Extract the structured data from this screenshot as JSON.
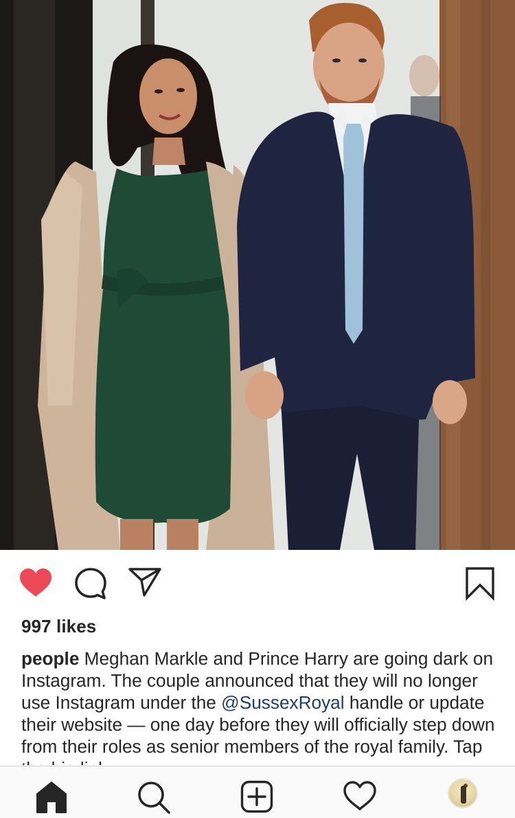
{
  "post": {
    "photo_alt": "",
    "actions": {
      "like_icon": "heart-filled-icon",
      "like_color": "#ed4956",
      "comment_icon": "comment-bubble-icon",
      "share_icon": "paper-plane-icon",
      "save_icon": "bookmark-icon"
    },
    "likes_text": "997 likes",
    "caption": {
      "username": "people",
      "text_before_mention": " Meghan Markle and Prince Harry are going dark on Instagram. The couple announced that they will no longer use Instagram under the ",
      "mention": "@SussexRoyal",
      "text_after_mention": " handle or update their website — one day before they will officially step down from their roles as senior members of the royal family. Tap the bio link",
      "mention_color": "#1b3f70"
    }
  },
  "tabbar": {
    "items": [
      {
        "name": "home",
        "icon": "home-filled-icon",
        "active": true
      },
      {
        "name": "search",
        "icon": "search-icon",
        "active": false
      },
      {
        "name": "new-post",
        "icon": "plus-square-icon",
        "active": false
      },
      {
        "name": "activity",
        "icon": "heart-outline-icon",
        "active": false
      },
      {
        "name": "profile",
        "icon": "profile-avatar-icon",
        "active": false
      }
    ]
  }
}
